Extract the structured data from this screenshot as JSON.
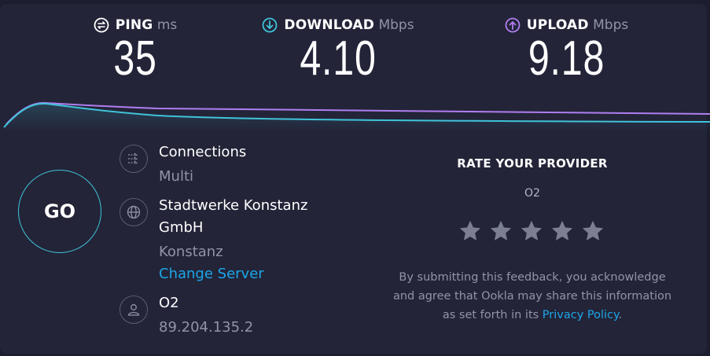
{
  "metrics": {
    "ping": {
      "label": "PING",
      "unit": "ms",
      "value": "35",
      "icon": "ping-icon",
      "color": "#ffffff"
    },
    "download": {
      "label": "DOWNLOAD",
      "unit": "Mbps",
      "value": "4.10",
      "icon": "download-arrow-icon",
      "color": "#40c3d9"
    },
    "upload": {
      "label": "UPLOAD",
      "unit": "Mbps",
      "value": "9.18",
      "icon": "upload-arrow-icon",
      "color": "#b07ef0"
    }
  },
  "go_label": "GO",
  "connections": {
    "title": "Connections",
    "value": "Multi",
    "icon": "connections-icon"
  },
  "server": {
    "name_line1": "Stadtwerke Konstanz",
    "name_line2": "GmbH",
    "location": "Konstanz",
    "change_link": "Change Server",
    "icon": "globe-icon"
  },
  "provider": {
    "name": "O2",
    "ip": "89.204.135.2",
    "icon": "user-icon"
  },
  "rate": {
    "title": "RATE YOUR PROVIDER",
    "isp": "O2",
    "stars": 5,
    "star_color": "#7c7e92",
    "legal_line1": "By submitting this feedback, you acknowledge",
    "legal_line2": "and agree that Ookla may share this information",
    "legal_line3_prefix": "as set forth in its",
    "privacy_link": "Privacy Policy",
    "legal_suffix": "."
  },
  "colors": {
    "background": "#232438",
    "download": "#40c3d9",
    "upload": "#b07ef0",
    "link": "#1ca6e8",
    "muted": "#9193a8"
  }
}
